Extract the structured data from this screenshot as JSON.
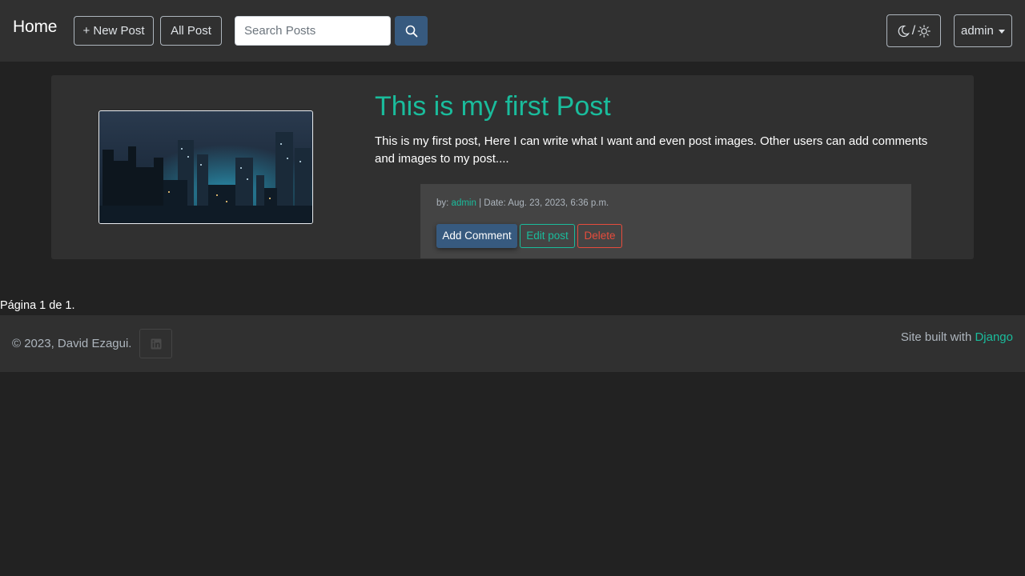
{
  "navbar": {
    "brand": "Home",
    "new_post": "+ New Post",
    "all_post": "All Post",
    "search_placeholder": "Search Posts",
    "theme_separator": "/",
    "user": "admin"
  },
  "post": {
    "title": "This is my first Post",
    "body": "This is my first post, Here I can write what I want and even post images. Other users can add comments and images to my post....",
    "meta_by": "by:",
    "author": "admin",
    "meta_date": "| Date: Aug. 23, 2023, 6:36 p.m.",
    "add_comment": "Add Comment",
    "edit": "Edit post",
    "delete": "Delete"
  },
  "pagination": {
    "text": "Página 1 de 1."
  },
  "footer": {
    "copyright": "© 2023, David Ezagui.",
    "built_with": "Site built with",
    "framework": "Django"
  },
  "colors": {
    "background": "#222222",
    "navbar": "#303030",
    "accent": "#1abc9c",
    "primary": "#375a7f",
    "danger": "#e74c3c"
  },
  "icons": [
    "search-icon",
    "moon-icon",
    "sun-icon",
    "caret-down-icon",
    "linkedin-icon"
  ]
}
